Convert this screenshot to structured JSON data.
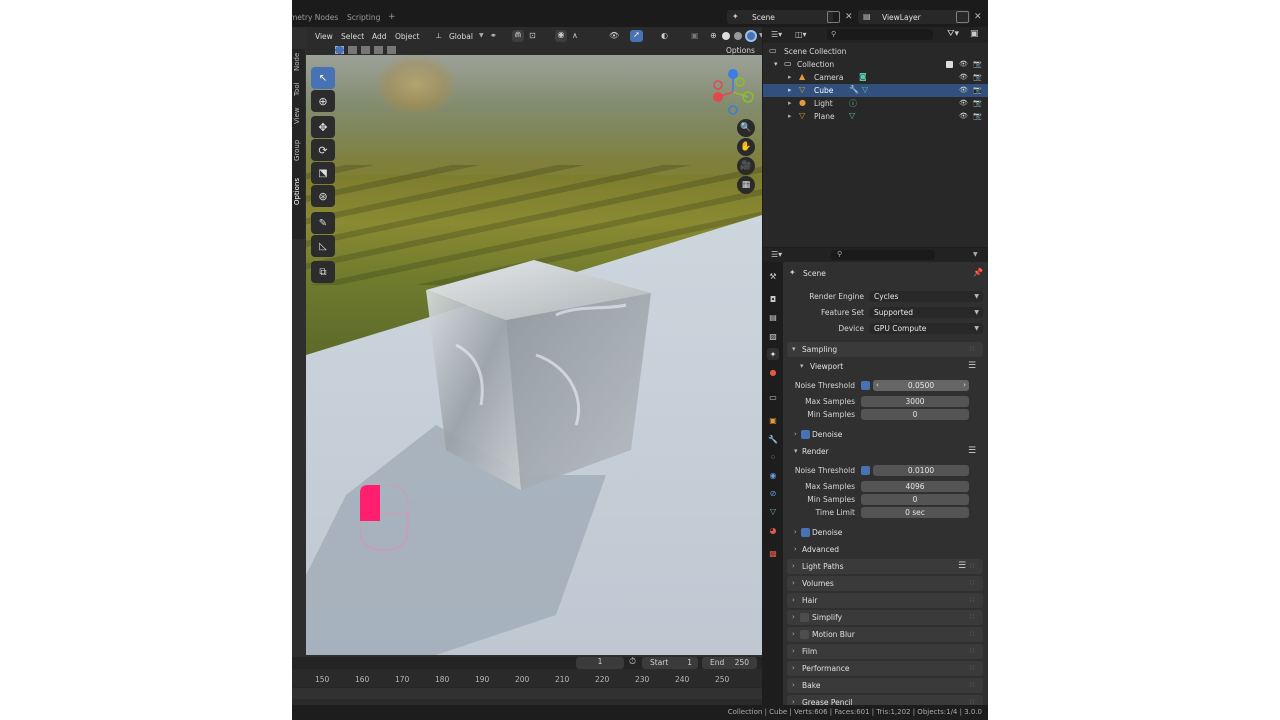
{
  "workspace_tabs": [
    "metry Nodes",
    "Scripting"
  ],
  "scene_name": "Scene",
  "view_layer_name": "ViewLayer",
  "viewport": {
    "menu": [
      "View",
      "Select",
      "Add",
      "Object"
    ],
    "orientation": "Global",
    "options_label": "Options",
    "side_tabs": [
      "Node",
      "Tool",
      "View",
      "Group",
      "Options"
    ]
  },
  "timeline": {
    "current_frame": "1",
    "start_label": "Start",
    "start_value": "1",
    "end_label": "End",
    "end_value": "250",
    "ruler": [
      "150",
      "160",
      "170",
      "180",
      "190",
      "200",
      "210",
      "220",
      "230",
      "240",
      "250"
    ]
  },
  "outliner": {
    "root": "Scene Collection",
    "collection": "Collection",
    "items": [
      {
        "label": "Camera",
        "icon": "camera-object-icon"
      },
      {
        "label": "Cube",
        "icon": "mesh-object-icon",
        "selected": true
      },
      {
        "label": "Light",
        "icon": "light-object-icon"
      },
      {
        "label": "Plane",
        "icon": "mesh-object-icon"
      }
    ]
  },
  "properties": {
    "context": "Scene",
    "render_engine_label": "Render Engine",
    "render_engine": "Cycles",
    "feature_set_label": "Feature Set",
    "feature_set": "Supported",
    "device_label": "Device",
    "device": "GPU Compute",
    "sampling": {
      "title": "Sampling",
      "viewport": {
        "title": "Viewport",
        "noise_threshold_label": "Noise Threshold",
        "noise_threshold": "0.0500",
        "max_samples_label": "Max Samples",
        "max_samples": "3000",
        "min_samples_label": "Min Samples",
        "min_samples": "0",
        "denoise_label": "Denoise"
      },
      "render": {
        "title": "Render",
        "noise_threshold_label": "Noise Threshold",
        "noise_threshold": "0.0100",
        "max_samples_label": "Max Samples",
        "max_samples": "4096",
        "min_samples_label": "Min Samples",
        "min_samples": "0",
        "time_limit_label": "Time Limit",
        "time_limit": "0 sec",
        "denoise_label": "Denoise"
      },
      "advanced": "Advanced"
    },
    "panels": [
      "Light Paths",
      "Volumes",
      "Hair",
      "Simplify",
      "Motion Blur",
      "Film",
      "Performance",
      "Bake",
      "Grease Pencil"
    ]
  },
  "status_bar": "Collection | Cube | Verts:606 | Faces:601 | Tris:1,202 | Objects:1/4 | 3.0.0",
  "colors": {
    "accent": "#4772b3",
    "selection": "#32507d",
    "panel_bg": "#303030",
    "cursor_pink": "#ff1f6e"
  }
}
